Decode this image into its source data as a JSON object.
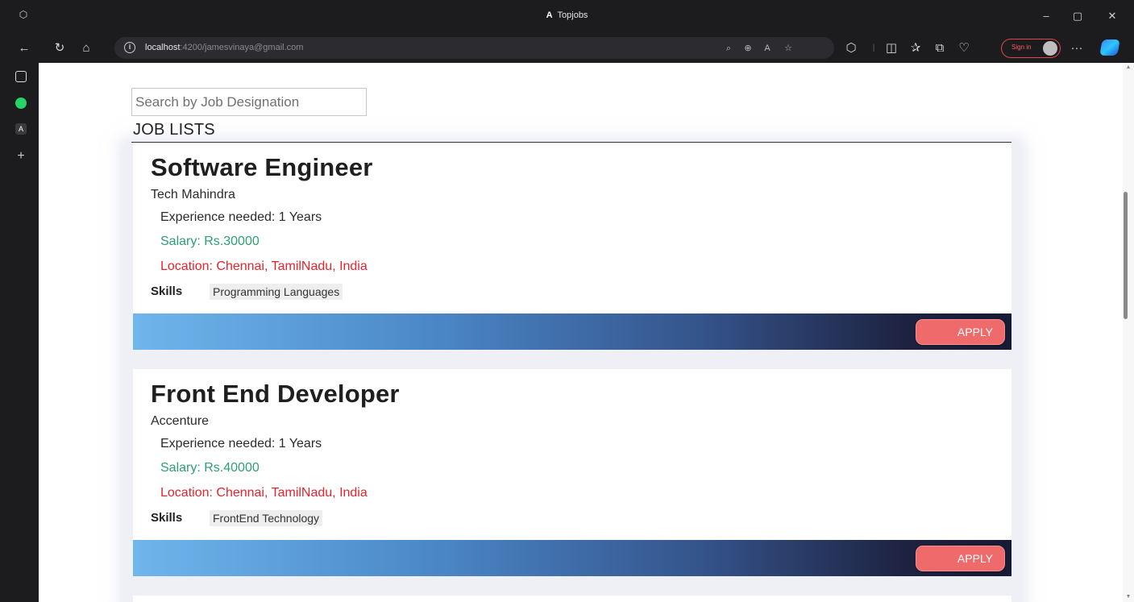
{
  "window": {
    "title": "Topjobs",
    "tab_logo": "A",
    "controls": {
      "minimize": "–",
      "restore": "▢",
      "close": "✕"
    }
  },
  "toolbar": {
    "url_host": "localhost",
    "url_rest": ":4200/jamesvinaya@gmail.com",
    "signin_label": "Sign in",
    "more": "···"
  },
  "sidebar": {
    "items": [
      "tab-actions",
      "whatsapp",
      "topjobs",
      "new-tab"
    ],
    "active_tab_letter": "A",
    "add_label": "+"
  },
  "page": {
    "search": {
      "placeholder": "Search by Job Designation",
      "value": ""
    },
    "list_title": "JOB LISTS",
    "jobs": [
      {
        "title": "Software Engineer",
        "company": "Tech Mahindra",
        "experience": "Experience needed: 1 Years",
        "salary": "Salary: Rs.30000",
        "location": "Location: Chennai, TamilNadu, India",
        "skills_label": "Skills",
        "skill": "Programming Languages",
        "apply_label": "APPLY"
      },
      {
        "title": "Front End Developer",
        "company": "Accenture",
        "experience": "Experience needed: 1 Years",
        "salary": "Salary: Rs.40000",
        "location": "Location: Chennai, TamilNadu, India",
        "skills_label": "Skills",
        "skill": "FrontEnd Technology",
        "apply_label": "APPLY"
      }
    ]
  },
  "colors": {
    "salary": "#2e9e74",
    "location": "#e3242b",
    "apply_button": "#ef6a6a",
    "footer_gradient_start": "#6fb6ec",
    "footer_gradient_end": "#161a33"
  }
}
